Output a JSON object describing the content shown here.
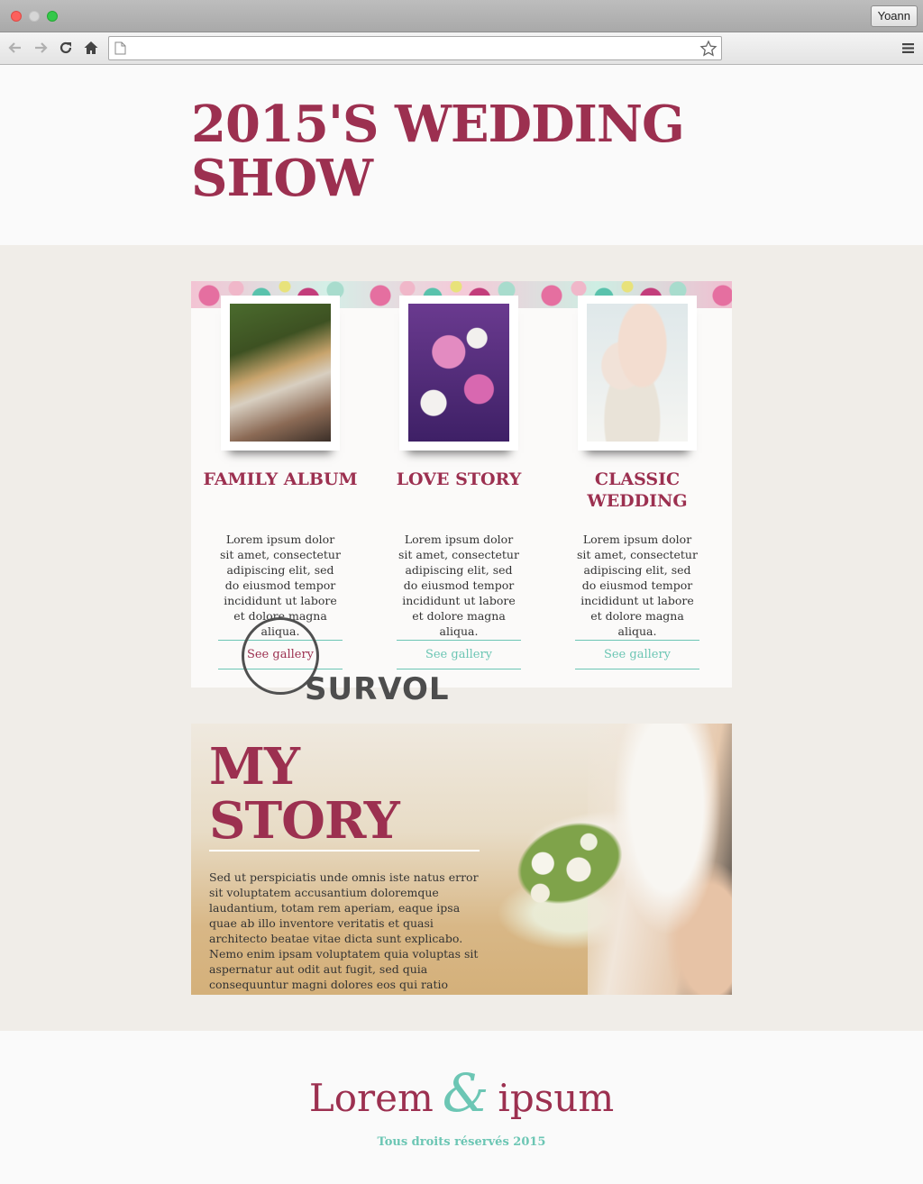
{
  "browser": {
    "profile_name": "Yoann",
    "url": ""
  },
  "hero": {
    "title": "2015'S WEDDING SHOW"
  },
  "cards": [
    {
      "title": "FAMILY ALBUM",
      "text": "Lorem ipsum dolor sit amet, consectetur adipiscing elit, sed do eiusmod tempor incididunt ut labore et dolore magna aliqua.",
      "link_label": "See gallery",
      "photo_icon": "couple-photo"
    },
    {
      "title": "LOVE STORY",
      "text": "Lorem ipsum dolor sit amet, consectetur adipiscing elit, sed do eiusmod tempor incididunt ut labore et dolore magna aliqua.",
      "link_label": "See gallery",
      "photo_icon": "bouquet-photo"
    },
    {
      "title": "CLASSIC WEDDING",
      "text": "Lorem ipsum dolor sit amet, consectetur adipiscing elit, sed do eiusmod tempor incididunt ut labore et dolore magna aliqua.",
      "link_label": "See gallery",
      "photo_icon": "bride-photo"
    }
  ],
  "hover_annotation": {
    "label": "SURVOL"
  },
  "story": {
    "title": "MY STORY",
    "text": "Sed ut perspiciatis unde omnis iste natus error sit voluptatem accusantium doloremque laudantium, totam rem aperiam, eaque ipsa quae ab illo inventore veritatis et quasi architecto beatae vitae dicta sunt explicabo. Nemo enim ipsam voluptatem quia voluptas sit aspernatur aut odit aut fugit, sed quia consequuntur magni dolores eos qui ratio"
  },
  "footer": {
    "brand_left": "Lorem",
    "brand_amp": "&",
    "brand_right": "ipsum",
    "copyright": "Tous droits réservés 2015"
  },
  "colors": {
    "brand_primary": "#9c3050",
    "accent_teal": "#6cc6b4",
    "band_background": "#f0ede8",
    "page_background": "#fafafa"
  }
}
